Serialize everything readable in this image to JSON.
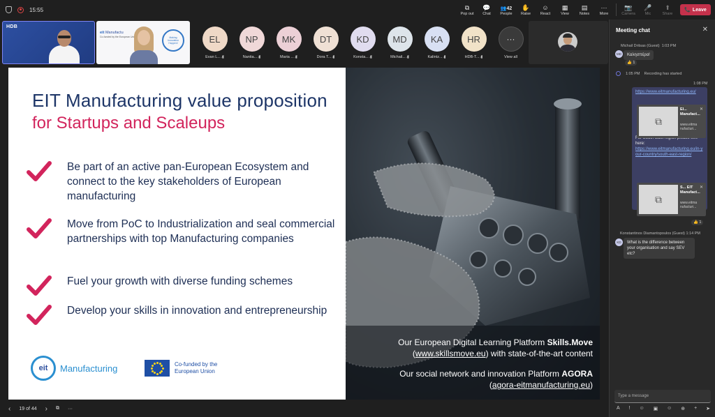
{
  "topbar": {
    "time": "15:55",
    "buttons": [
      {
        "name": "popout",
        "label": "Pop out",
        "icon": "⧉"
      },
      {
        "name": "chat",
        "label": "Chat",
        "icon": "💬"
      },
      {
        "name": "people",
        "label": "People",
        "icon": "👥",
        "count": "42"
      },
      {
        "name": "raise",
        "label": "Raise",
        "icon": "✋"
      },
      {
        "name": "react",
        "label": "React",
        "icon": "☺"
      },
      {
        "name": "view",
        "label": "View",
        "icon": "▦"
      },
      {
        "name": "notes",
        "label": "Notes",
        "icon": "▤"
      },
      {
        "name": "more",
        "label": "More",
        "icon": "···"
      }
    ],
    "device_buttons": [
      {
        "name": "camera",
        "label": "Camera",
        "icon": "📷"
      },
      {
        "name": "mic",
        "label": "Mic",
        "icon": "🎤"
      },
      {
        "name": "share",
        "label": "Share",
        "icon": "⬆"
      }
    ],
    "leave_label": "Leave",
    "leave_icon": "📞"
  },
  "videos": {
    "tile1_logo": "HDB",
    "tile2_logo_prefix": "eit",
    "tile2_logo_name": "Manufactu",
    "tile2_cofund": "Co-funded by the European Union",
    "tile2_ring": "Making Innovation Happen!"
  },
  "participants": [
    {
      "initials": "EL",
      "name": "Evan L...",
      "color": "#efd9c7"
    },
    {
      "initials": "NP",
      "name": "Nantia...",
      "color": "#f0d8d8"
    },
    {
      "initials": "MK",
      "name": "Maria ...",
      "color": "#ecd0d6"
    },
    {
      "initials": "DT",
      "name": "Dora T...",
      "color": "#efe0d4"
    },
    {
      "initials": "KD",
      "name": "Konsta...",
      "color": "#e0dcef"
    },
    {
      "initials": "MD",
      "name": "Michail...",
      "color": "#dde4ea"
    },
    {
      "initials": "KA",
      "name": "Kalintz...",
      "color": "#d8e0f3"
    },
    {
      "initials": "HR",
      "name": "HDB-T...",
      "color": "#f1e2c8"
    }
  ],
  "view_all_label": "View all",
  "slide": {
    "title": "EIT Manufacturing value proposition",
    "subtitle": "for Startups and Scaleups",
    "bullets": [
      "Be part of an active pan-European Ecosystem and connect to the key stakeholders of European manufacturing",
      "Move from PoC to Industrialization and seal commercial partnerships with top Manufacturing companies",
      "Fuel your growth with diverse funding schemes",
      "Develop your skills in innovation and entrepreneurship"
    ],
    "logo_eit": "eit",
    "logo_manufacturing": "Manufacturing",
    "cofund_line1": "Co-funded by the",
    "cofund_line2": "European Union",
    "caption1_pre": "Our European Digital Learning Platform ",
    "caption1_bold": "Skills.Move",
    "caption1_link": "www.skillsmove.eu",
    "caption1_post": " with state-of-the-art content",
    "caption2_pre": "Our social network and innovation Platform ",
    "caption2_bold": "AGORA",
    "caption2_link": "agora-eitmanufacturing.eu"
  },
  "slide_controls": {
    "page": "19 of 44"
  },
  "chat": {
    "header": "Meeting chat",
    "msg1_author": "Michail Dritsas (Guest)",
    "msg1_time": "1:03 PM",
    "msg1_initials": "MD",
    "msg1_text": "Καλησπέρα!",
    "msg1_react": "👍 1",
    "rec_time": "1:05 PM",
    "rec_text": "Recording has started",
    "msg2_time": "1:08 PM",
    "msg2_link": "https://www.eitmanufacturing.eu/",
    "card1_title": "EI... Manufact...",
    "card1_url": "www.eitma nufacturi...",
    "msg3_text": "For South East region please see here:",
    "msg3_link": "https://www.eitmanufacturing.eu/in-your-country/south-east-region/",
    "card2_title": "S... EIT Manufact...",
    "card2_url": "www.eitma nufacturi...",
    "msg3_react": "👍 1",
    "msg4_author": "Konstantinos Diamantopoulos (Guest)",
    "msg4_time": "1:14 PM",
    "msg4_initials": "KD",
    "msg4_text": "What is the difference between your organisation and say SEV etc?",
    "input_placeholder": "Type a message",
    "tools": [
      "A",
      "!",
      "☺",
      "▣",
      "☺",
      "⊕",
      "+",
      "➤"
    ]
  }
}
